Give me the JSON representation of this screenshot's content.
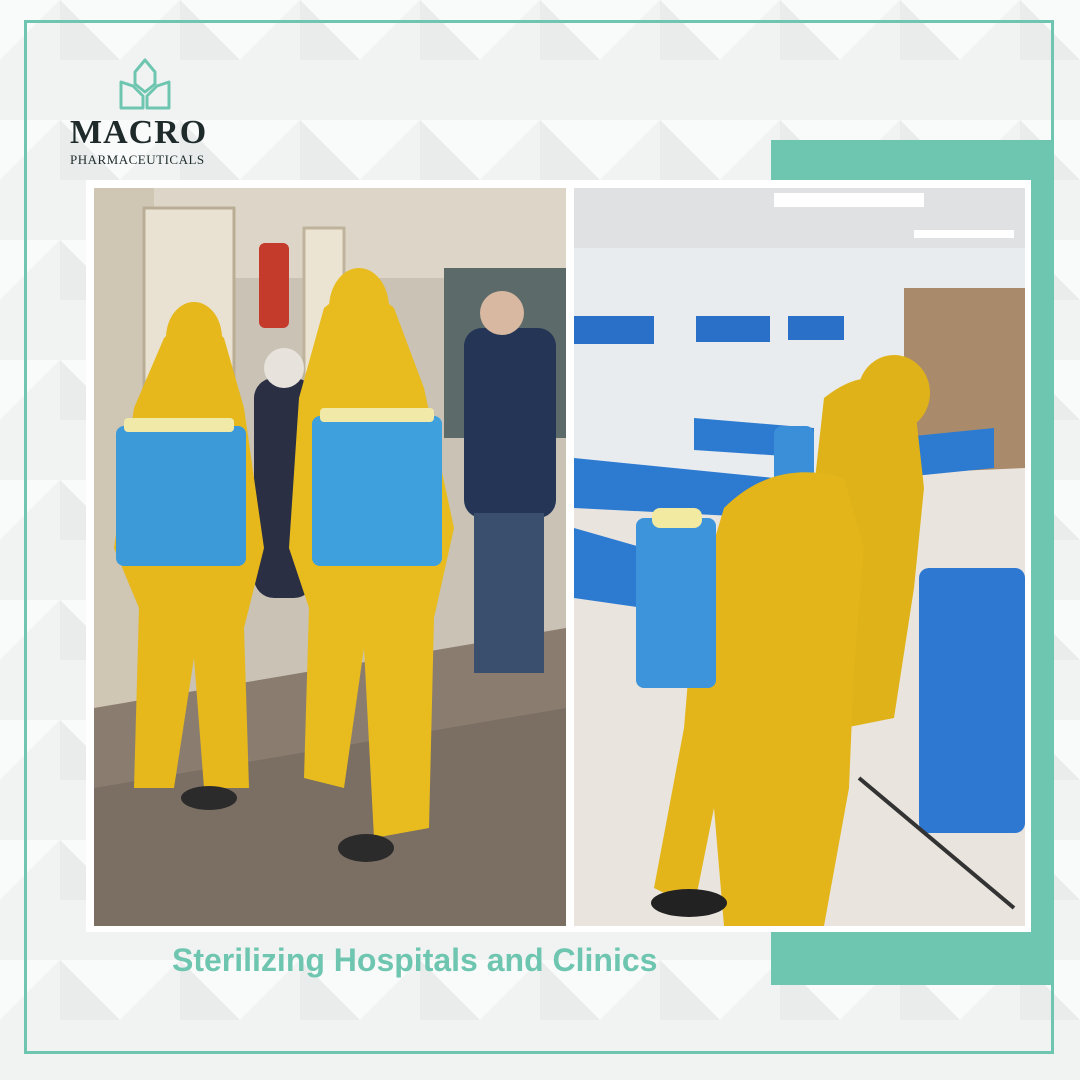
{
  "brand": {
    "name": "MACRO",
    "tagline": "PHARMACEUTICALS",
    "icon": "leaf-logo-icon",
    "color": "#6fc6b0"
  },
  "caption": "Sterilizing Hospitals and Clinics",
  "photos": [
    {
      "name": "corridor-spraying-photo"
    },
    {
      "name": "ward-spraying-photo"
    }
  ]
}
